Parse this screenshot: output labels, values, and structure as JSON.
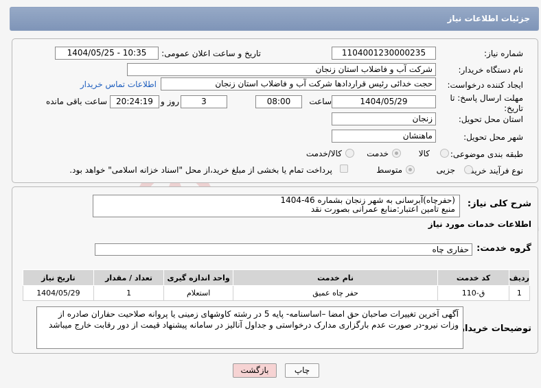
{
  "title": "جزئیات اطلاعات نیاز",
  "fields": {
    "need_number_label": "شماره نیاز:",
    "need_number": "1104001230000235",
    "announce_label": "تاریخ و ساعت اعلان عمومی:",
    "announce_value": "1404/05/25 - 10:35",
    "buyer_label": "نام دستگاه خریدار:",
    "buyer_value": "شرکت آب و فاضلاب استان زنجان",
    "creator_label": "ایجاد کننده درخواست:",
    "creator_value": "حجت  خدائی رئیس قراردادها شرکت آب و فاضلاب استان زنجان",
    "contact_link": "اطلاعات تماس خریدار",
    "deadline_label": "مهلت ارسال پاسخ: تا تاریخ:",
    "deadline_date": "1404/05/29",
    "time_label": "ساعت",
    "deadline_time": "08:00",
    "days_value": "3",
    "days_label": "روز و",
    "remaining_value": "20:24:19",
    "remaining_label": "ساعت باقی مانده",
    "province_label": "استان محل تحویل:",
    "province_value": "زنجان",
    "city_label": "شهر محل تحویل:",
    "city_value": "ماهنشان",
    "category_label": "طبقه بندی موضوعی:",
    "category_options": [
      "کالا",
      "خدمت",
      "کالا/خدمت"
    ],
    "process_label": "نوع فرآیند خرید :",
    "process_options": [
      "جزیی",
      "متوسط"
    ],
    "payment_note": "پرداخت تمام یا بخشی از مبلغ خرید،از محل \"اسناد خزانه اسلامی\" خواهد بود."
  },
  "general": {
    "desc_label": "شرح کلی نیاز:",
    "desc_line1": "(حفرچاه)آبرسانی به شهر زنجان بشماره 46-1404",
    "desc_line2": "منبع تامین اعتبار:منابع عمرانی بصورت نقد",
    "services_heading": "اطلاعات خدمات مورد نیاز",
    "group_label": "گروه خدمت:",
    "group_value": "حفاری چاه"
  },
  "table": {
    "headers": [
      "ردیف",
      "کد خدمت",
      "نام خدمت",
      "واحد اندازه گیری",
      "تعداد / مقدار",
      "تاریخ نیاز"
    ],
    "rows": [
      [
        "1",
        "ق-110",
        "حفر چاه عمیق",
        "استعلام",
        "1",
        "1404/05/29"
      ]
    ]
  },
  "notes": {
    "label": "توضیحات خریدار:",
    "text": "آگهی آخرین تغییرات صاحبان حق امضا –اساسنامه- پایه 5 در رشته کاوشهای زمینی یا پروانه صلاحیت حفاران صادره از وزات نیرو-در صورت عدم بارگزاری مدارک درخواستی و جداول آنالیز در سامانه پیشنهاد قیمت از دور رقابت خارج میباشد"
  },
  "buttons": {
    "print": "چاپ",
    "back": "بازگشت"
  },
  "watermark": "AriaTender.neT",
  "colors": {
    "titlebar": "#8a9fc0",
    "link": "#1f5fbf",
    "back_button_bg": "#f6d3d3"
  }
}
